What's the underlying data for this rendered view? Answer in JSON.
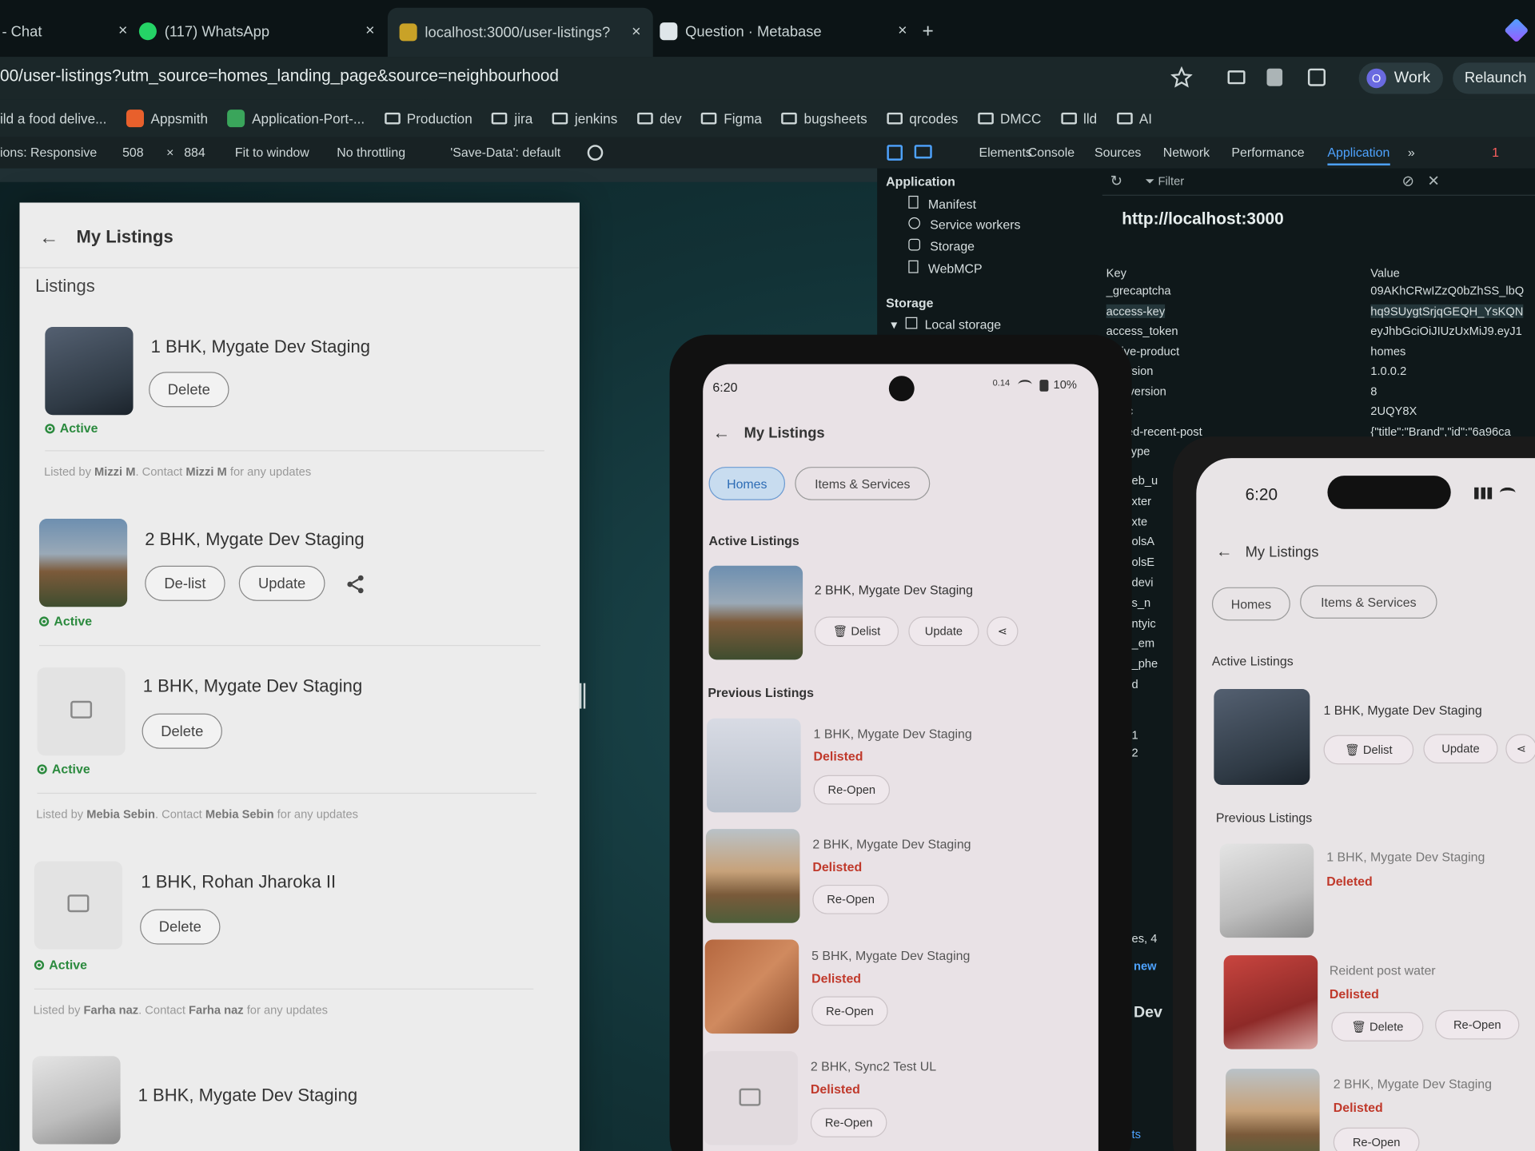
{
  "browser": {
    "tabs": [
      {
        "label": "- Chat",
        "close": "×"
      },
      {
        "label": "(117) WhatsApp",
        "close": "×"
      },
      {
        "label": "localhost:3000/user-listings?",
        "close": "×"
      },
      {
        "label": "Question · Metabase",
        "close": "×"
      }
    ],
    "new_tab": "+",
    "url": "00/user-listings?utm_source=homes_landing_page&source=neighbourhood",
    "profile_initial": "O",
    "profile_label": "Work",
    "relaunch": "Relaunch",
    "bookmarks": [
      "ild a food delive...",
      "Appsmith",
      "Application-Port-...",
      "Production",
      "jira",
      "jenkins",
      "dev",
      "Figma",
      "bugsheets",
      "qrcodes",
      "DMCC",
      "lld",
      "AI"
    ],
    "device_toolbar": {
      "dimensions_label": "ions: Responsive",
      "width": "508",
      "times": "×",
      "height": "884",
      "fit": "Fit to window",
      "throttle": "No throttling",
      "save_data": "'Save-Data': default"
    },
    "devtools_tabs": [
      "Elements",
      "Console",
      "Sources",
      "Network",
      "Performance",
      "Application"
    ],
    "error_count": "1"
  },
  "devtools": {
    "section_application": "Application",
    "app_items": [
      "Manifest",
      "Service workers",
      "Storage",
      "WebMCP"
    ],
    "section_storage": "Storage",
    "local_storage": "Local storage",
    "filter_placeholder": "Filter",
    "origin": "http://localhost:3000",
    "key_header": "Key",
    "value_header": "Value",
    "rows": [
      {
        "key": "_grecaptcha",
        "value": "09AKhCRwIZzQ0bZhSS_lbQ"
      },
      {
        "key": "access-key",
        "value": "hq9SUygtSrjqGEQH_YsKQN"
      },
      {
        "key": "access_token",
        "value": "eyJhbGciOiJIUzUxMiJ9.eyJ1"
      },
      {
        "key": "tive-product",
        "value": "homes"
      },
      {
        "key": "/ersion",
        "value": "1.0.0.2"
      },
      {
        "key": "e-version",
        "value": "8"
      },
      {
        "key": "loc",
        "value": "2UQY8X"
      },
      {
        "key": "ified-recent-post",
        "value": "{\"title\":\"Brand\",\"id\":\"6a96ca"
      },
      {
        "key": "eType",
        "value": ""
      }
    ],
    "partial_keys": [
      "eb_u",
      "xter",
      "xte",
      "olsA",
      "olsE",
      "devi",
      "s_n",
      "ntyic",
      "_em",
      "_phe",
      "d"
    ],
    "numbers": [
      "1",
      "2"
    ],
    "bottom_bits": [
      "es, 4",
      "new",
      "Dev",
      "ts"
    ]
  },
  "page": {
    "title": "My Listings",
    "section": "Listings",
    "listings": [
      {
        "title": "1 BHK, Mygate Dev Staging",
        "buttons": [
          "Delete"
        ],
        "status": "Active",
        "listed_by": "Mizzi M"
      },
      {
        "title": "2 BHK, Mygate Dev Staging",
        "buttons": [
          "De-list",
          "Update"
        ],
        "status": "Active"
      },
      {
        "title": "1 BHK, Mygate Dev Staging",
        "buttons": [
          "Delete"
        ],
        "status": "Active",
        "listed_by": "Mebia Sebin"
      },
      {
        "title": "1 BHK, Rohan Jharoka II",
        "buttons": [
          "Delete"
        ],
        "status": "Active",
        "listed_by": "Farha naz"
      },
      {
        "title": "1 BHK, Mygate Dev Staging"
      }
    ],
    "listed_by_prefix": "Listed by",
    "contact_prefix": "Contact",
    "contact_suffix": "for any updates"
  },
  "phone1": {
    "time": "6:20",
    "net_speed": "0.14",
    "battery": "10%",
    "title": "My Listings",
    "tabs": [
      "Homes",
      "Items & Services"
    ],
    "active_header": "Active Listings",
    "active": {
      "title": "2 BHK, Mygate Dev Staging",
      "delist": "Delist",
      "update": "Update"
    },
    "previous_header": "Previous Listings",
    "previous": [
      {
        "title": "1 BHK, Mygate Dev Staging",
        "status": "Delisted",
        "action": "Re-Open"
      },
      {
        "title": "2 BHK, Mygate Dev Staging",
        "status": "Delisted",
        "action": "Re-Open"
      },
      {
        "title": "5 BHK, Mygate Dev Staging",
        "status": "Delisted",
        "action": "Re-Open"
      },
      {
        "title": "2 BHK, Sync2 Test UL",
        "status": "Delisted",
        "action": "Re-Open"
      }
    ]
  },
  "phone2": {
    "time": "6:20",
    "title": "My Listings",
    "tabs": [
      "Homes",
      "Items & Services"
    ],
    "active_header": "Active Listings",
    "active": {
      "title": "1 BHK, Mygate Dev Staging",
      "delist": "Delist",
      "update": "Update"
    },
    "previous_header": "Previous Listings",
    "previous": [
      {
        "title": "1 BHK, Mygate Dev Staging",
        "status": "Deleted"
      },
      {
        "title": "Reident post water",
        "status": "Delisted",
        "delete": "Delete",
        "reopen": "Re-Open"
      },
      {
        "title": "2 BHK, Mygate Dev Staging",
        "status": "Delisted",
        "reopen": "Re-Open"
      }
    ]
  },
  "colors": {
    "active_green": "#2b8a3e",
    "delisted_red": "#c0392b",
    "selected_tab_blue": "#2d6cb5",
    "devtools_active": "#4ea3ff"
  }
}
